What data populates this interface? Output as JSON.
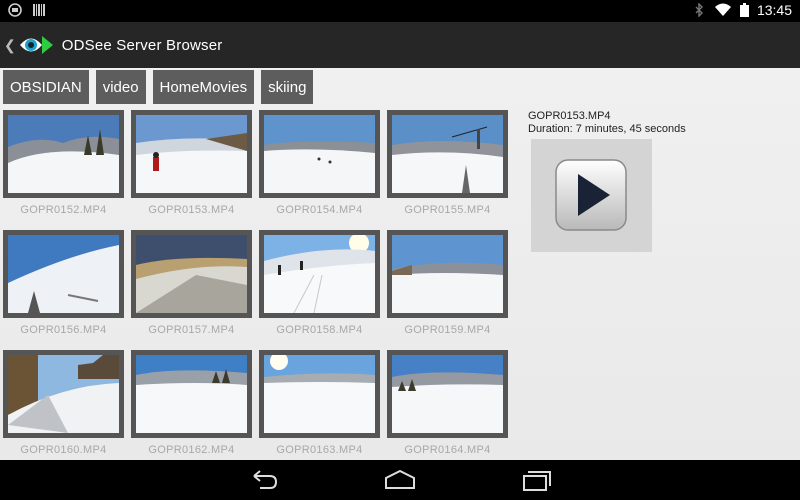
{
  "status_bar": {
    "time": "13:45",
    "icons": [
      "notification-circle-icon",
      "barcode-icon",
      "bluetooth-icon",
      "wifi-icon",
      "battery-icon"
    ]
  },
  "action_bar": {
    "title": "ODSee Server Browser",
    "icon": "odsee-eye-play-icon"
  },
  "breadcrumbs": [
    "OBSIDIAN",
    "video",
    "HomeMovies",
    "skiing"
  ],
  "files": [
    {
      "name": "GOPR0152.MP4"
    },
    {
      "name": "GOPR0153.MP4"
    },
    {
      "name": "GOPR0154.MP4"
    },
    {
      "name": "GOPR0155.MP4"
    },
    {
      "name": "GOPR0156.MP4"
    },
    {
      "name": "GOPR0157.MP4"
    },
    {
      "name": "GOPR0158.MP4"
    },
    {
      "name": "GOPR0159.MP4"
    },
    {
      "name": "GOPR0160.MP4"
    },
    {
      "name": "GOPR0162.MP4"
    },
    {
      "name": "GOPR0163.MP4"
    },
    {
      "name": "GOPR0164.MP4"
    }
  ],
  "detail": {
    "filename": "GOPR0153.MP4",
    "duration": "Duration: 7 minutes, 45 seconds",
    "play_icon": "play-icon"
  },
  "nav_bar": {
    "buttons": [
      "back-icon",
      "home-icon",
      "recent-apps-icon"
    ]
  },
  "colors": {
    "action_bar": "#262626",
    "crumb_bg": "#5d5d5d",
    "accent_green": "#2ecc40",
    "accent_teal": "#1fa3c4"
  }
}
